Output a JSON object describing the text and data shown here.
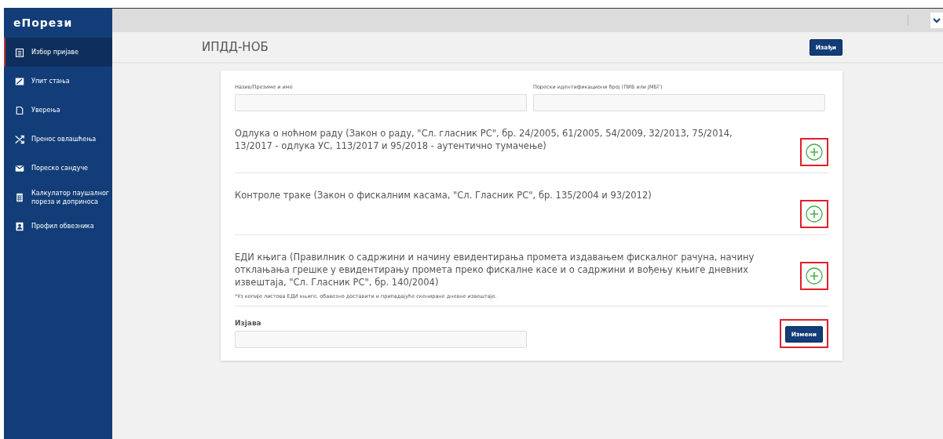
{
  "logo": "еПорези",
  "sidebar": {
    "items": [
      {
        "label": "Избор пријаве",
        "kind": "clipboard",
        "selected": true
      },
      {
        "label": "Упит стања",
        "kind": "chart",
        "selected": false
      },
      {
        "label": "Уверења",
        "kind": "document",
        "selected": false
      },
      {
        "label": "Пренос овлашћења",
        "kind": "shuffle",
        "selected": false
      },
      {
        "label": "Пореско сандуче",
        "kind": "envelope",
        "selected": false
      },
      {
        "label": "Калкулатор паушалног пореза и доприноса",
        "kind": "calculator",
        "selected": false
      },
      {
        "label": "Профил обвезника",
        "kind": "profile",
        "selected": false
      }
    ]
  },
  "header": {
    "title": "ИПДД-НОБ",
    "exit_button": "Изађи"
  },
  "form": {
    "fields": [
      {
        "label": "Назив/Презиме и име"
      },
      {
        "label": "Порески идентификациони број (ПИБ или ЈМБГ)"
      }
    ],
    "sections": [
      {
        "title": "Одлука о ноћном раду (Закон о раду, \"Сл. гласник РС\", бр. 24/2005, 61/2005, 54/2009, 32/2013, 75/2014, 13/2017 - одлука УС, 113/2017 и 95/2018 - аутентично тумачење)",
        "highlighted": true
      },
      {
        "title": "Контроле траке (Закон о фискалним касама, \"Сл. Гласник РС\", бр. 135/2004 и 93/2012)",
        "highlighted": true
      },
      {
        "title": "ЕДИ књига (Правилник о садржини и начину евидентирања промета издавањем фискалног рачуна, начину отклањања грешке у евидентирању промета преко фискалне касе и о садржини и вођењу књиге дневних извештаја, \"Сл. Гласник РС\", бр. 140/2004)",
        "note": "*Уз копије листова ЕДИ књиге, обавезно доставити и припадајуће скениране дневне извештаје.",
        "highlighted": true
      }
    ],
    "statement": {
      "label": "Изјава",
      "button": "Измени",
      "highlighted": true
    }
  }
}
